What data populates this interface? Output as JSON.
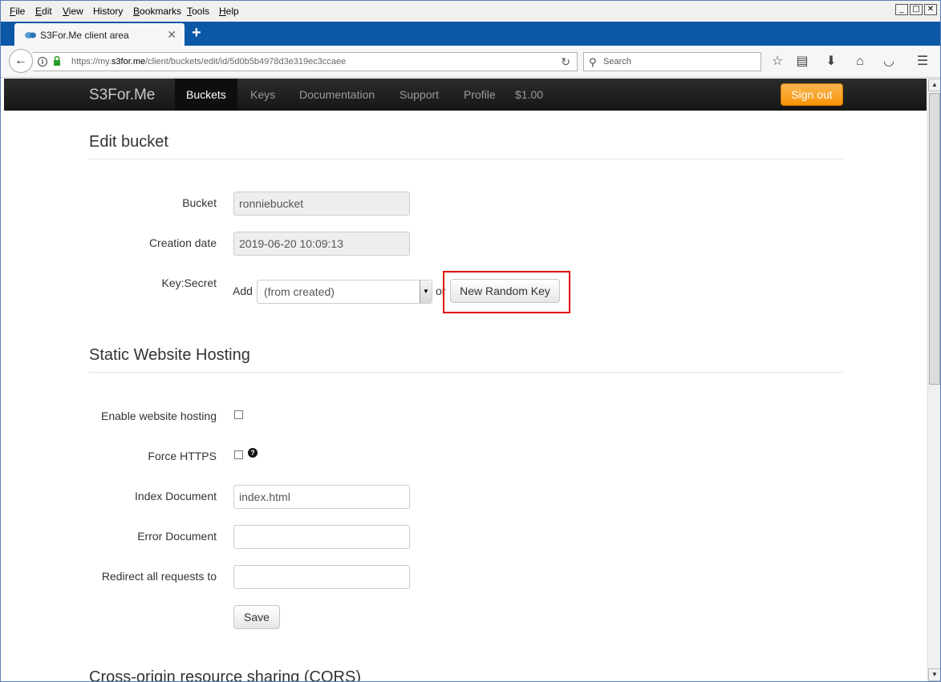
{
  "menubar": {
    "items": [
      "File",
      "Edit",
      "View",
      "History",
      "Bookmarks",
      "Tools",
      "Help"
    ],
    "accel": [
      "F",
      "E",
      "V",
      "S",
      "B",
      "T",
      "H"
    ]
  },
  "window_controls": {
    "minimize": "_",
    "maximize": "□",
    "close": "✕"
  },
  "tab": {
    "title": "S3For.Me client area",
    "close": "✕",
    "new": "+"
  },
  "nav": {
    "url_prefix": "https://my.",
    "url_domain": "s3for.me",
    "url_path": "/client/buckets/edit/id/5d0b5b4978d3e319ec3ccaee",
    "search_placeholder": "Search"
  },
  "site": {
    "brand": "S3For.Me",
    "links": [
      "Buckets",
      "Keys",
      "Documentation",
      "Support",
      "Profile",
      "$1.00"
    ],
    "sign_out": "Sign out"
  },
  "edit_bucket": {
    "heading": "Edit bucket",
    "bucket_label": "Bucket",
    "bucket_value": "ronniebucket",
    "creation_label": "Creation date",
    "creation_value": "2019-06-20 10:09:13",
    "key_label": "Key:Secret",
    "add_text": "Add",
    "key_select": "(from created)",
    "or_text": "or",
    "random_key_button": "New Random Key"
  },
  "hosting": {
    "heading": "Static Website Hosting",
    "enable_label": "Enable website hosting",
    "https_label": "Force HTTPS",
    "help": "?",
    "index_label": "Index Document",
    "index_value": "index.html",
    "error_label": "Error Document",
    "error_value": "",
    "redirect_label": "Redirect all requests to",
    "redirect_value": "",
    "save_button": "Save"
  },
  "cors": {
    "heading": "Cross-origin resource sharing (CORS)"
  }
}
